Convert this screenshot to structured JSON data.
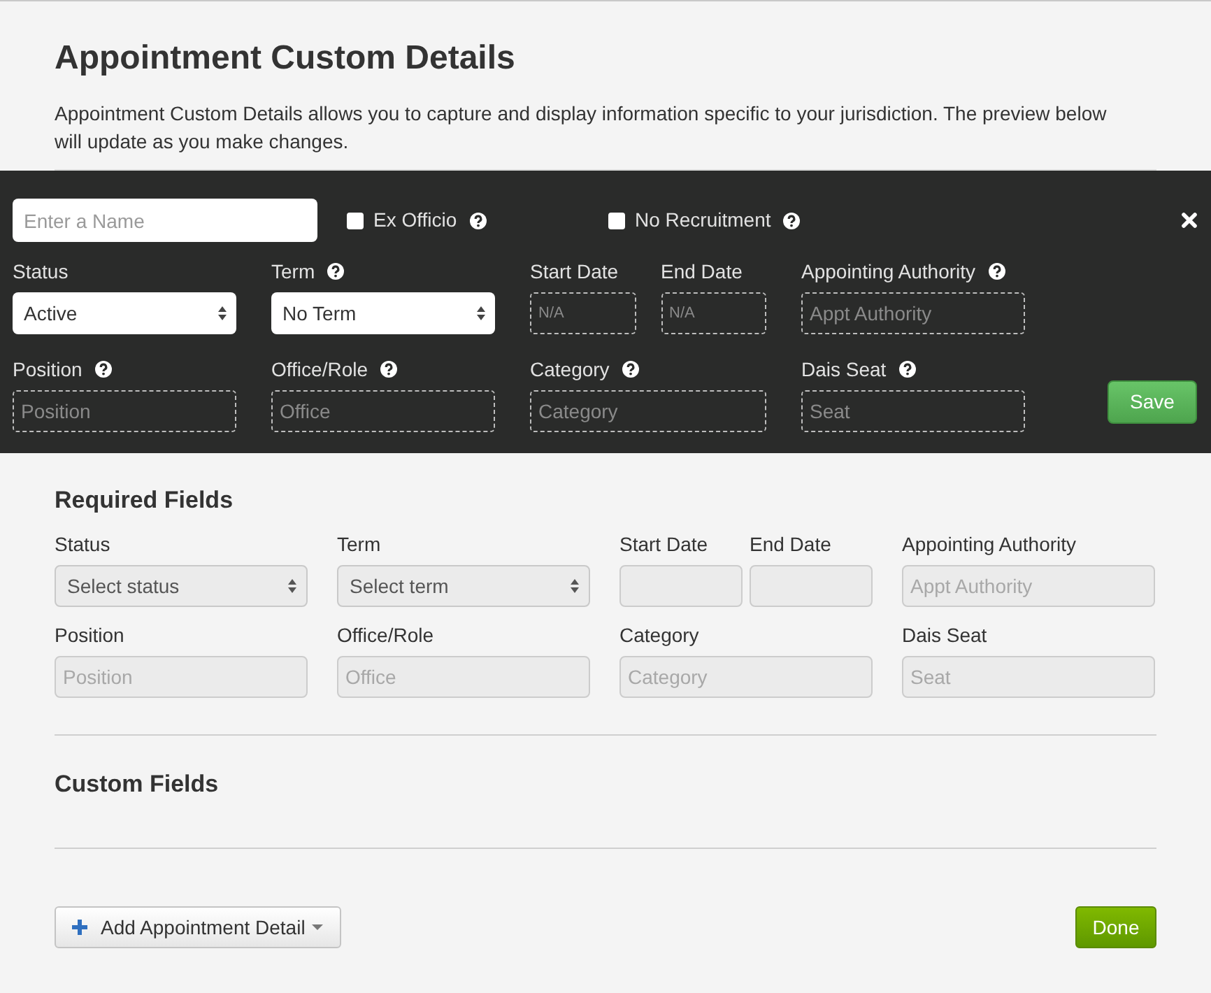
{
  "page": {
    "title": "Appointment Custom Details",
    "description": "Appointment Custom Details allows you to capture and display information specific to your jurisdiction. The preview below will update as you make changes."
  },
  "editor": {
    "name_field": {
      "placeholder": "Enter a Name"
    },
    "checkboxes": [
      {
        "label": "Ex Officio",
        "checked": false,
        "help": true
      },
      {
        "label": "No Recruitment",
        "checked": false,
        "help": true
      }
    ],
    "rows": [
      [
        {
          "label": "Status",
          "kind": "select",
          "value": "Active",
          "help": false
        },
        {
          "label": "Term",
          "kind": "select",
          "value": "No Term",
          "help": true
        },
        {
          "kind": "date_range",
          "fields": [
            {
              "label": "Start Date",
              "kind": "date",
              "placeholder": "N/A",
              "help": false
            },
            {
              "label": "End Date",
              "kind": "date",
              "placeholder": "N/A",
              "help": false
            }
          ]
        },
        {
          "label": "Appointing Authority",
          "kind": "text",
          "placeholder": "Appt Authority",
          "help": true
        }
      ],
      [
        {
          "label": "Position",
          "kind": "text",
          "placeholder": "Position",
          "help": true
        },
        {
          "label": "Office/Role",
          "kind": "text",
          "placeholder": "Office",
          "help": true
        },
        {
          "label": "Category",
          "kind": "text",
          "placeholder": "Category",
          "help": true
        },
        {
          "label": "Dais Seat",
          "kind": "text",
          "placeholder": "Seat",
          "help": true
        }
      ]
    ],
    "save_button": "Save"
  },
  "required_fields": {
    "heading": "Required Fields",
    "rows": [
      [
        {
          "label": "Status",
          "kind": "select",
          "value": "Select status",
          "disabled": true
        },
        {
          "label": "Term",
          "kind": "select",
          "value": "Select term",
          "disabled": true
        },
        {
          "kind": "date_range",
          "fields": [
            {
              "label": "Start Date",
              "kind": "date",
              "disabled": true
            },
            {
              "label": "End Date",
              "kind": "date",
              "disabled": true
            }
          ]
        },
        {
          "label": "Appointing Authority",
          "kind": "text",
          "placeholder": "Appt Authority",
          "disabled": true
        }
      ],
      [
        {
          "label": "Position",
          "kind": "text",
          "placeholder": "Position",
          "disabled": true
        },
        {
          "label": "Office/Role",
          "kind": "text",
          "placeholder": "Office",
          "disabled": true
        },
        {
          "label": "Category",
          "kind": "text",
          "placeholder": "Category",
          "disabled": true
        },
        {
          "label": "Dais Seat",
          "kind": "text",
          "placeholder": "Seat",
          "disabled": true
        }
      ]
    ]
  },
  "custom_fields": {
    "heading": "Custom Fields"
  },
  "footer": {
    "add_button": "Add Appointment Detail",
    "done_button": "Done"
  }
}
